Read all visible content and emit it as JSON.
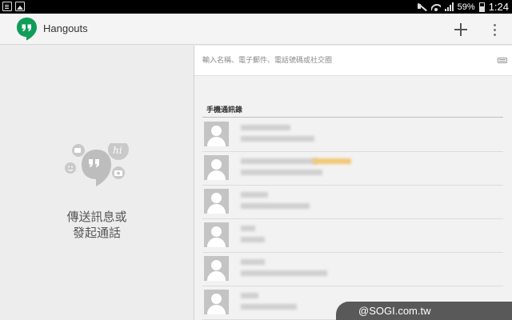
{
  "status_bar": {
    "battery_percent": "59%",
    "time": "1:24"
  },
  "action_bar": {
    "title": "Hangouts"
  },
  "empty_state": {
    "line1": "傳送訊息或",
    "line2": "發起通話"
  },
  "search": {
    "placeholder": "輸入名稱、電子郵件、電話號碼或社交圈"
  },
  "contacts": {
    "section_title": "手機通訊錄"
  },
  "watermark": {
    "text": "@SOGI.com.tw"
  },
  "colors": {
    "hangouts_green": "#0f9d58",
    "status_bar": "#000000",
    "watermark_bg": "#595959"
  }
}
